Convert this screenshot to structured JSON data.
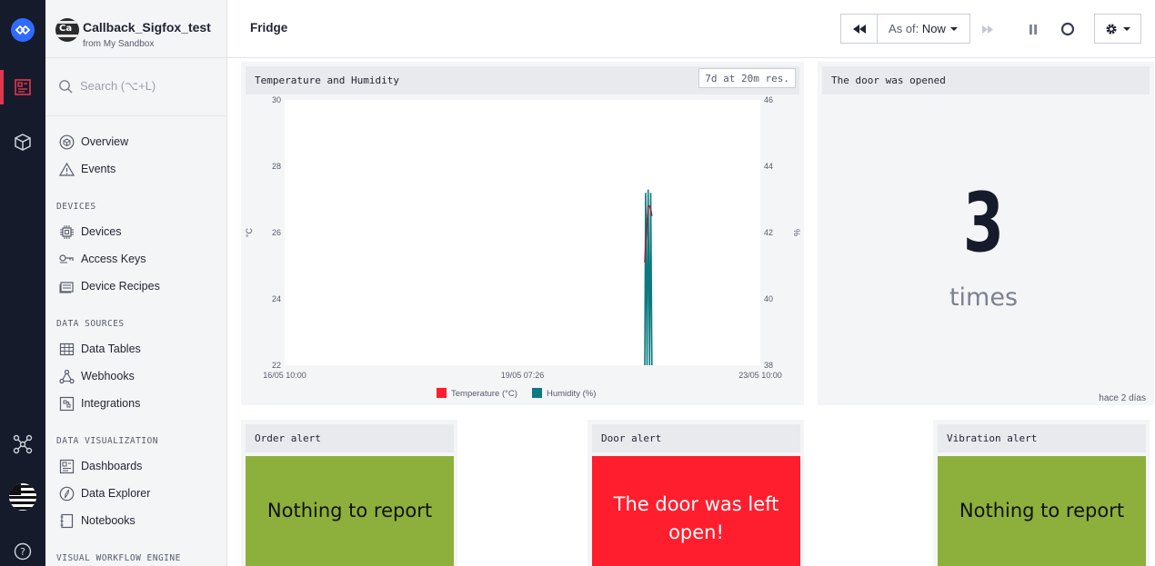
{
  "app": {
    "avatar_text": "Ca",
    "name": "Callback_Sigfox_test",
    "subtitle": "from My Sandbox"
  },
  "search": {
    "placeholder": "Search (⌥+L)"
  },
  "nav": {
    "overview": "Overview",
    "events": "Events",
    "devices_section": "DEVICES",
    "devices": "Devices",
    "access_keys": "Access Keys",
    "device_recipes": "Device Recipes",
    "data_sources_section": "DATA SOURCES",
    "data_tables": "Data Tables",
    "webhooks": "Webhooks",
    "integrations": "Integrations",
    "data_viz_section": "DATA VISUALIZATION",
    "dashboards": "Dashboards",
    "data_explorer": "Data Explorer",
    "notebooks": "Notebooks",
    "vwe_section": "VISUAL WORKFLOW ENGINE"
  },
  "header": {
    "title": "Fridge",
    "asof_label": "As of:",
    "asof_value": "Now"
  },
  "colors": {
    "accent": "#e0364f",
    "rail": "#161b2b",
    "temperature": "#ff1e2d",
    "humidity": "#0c7a7e",
    "ok": "#8db03c",
    "alarm": "#ff1e2d"
  },
  "chart_card": {
    "title": "Temperature and Humidity",
    "resolution": "7d at 20m res."
  },
  "chart_data": {
    "type": "line",
    "x_ticks": [
      "16/05 10:00",
      "19/05 07:26",
      "23/05 10:00"
    ],
    "y_left": {
      "label": "°C",
      "ticks": [
        30,
        28,
        26,
        24,
        22
      ],
      "range": [
        22,
        30
      ]
    },
    "y_right": {
      "label": "%",
      "ticks": [
        46,
        44,
        42,
        40,
        38
      ],
      "range": [
        38,
        46
      ]
    },
    "x_range": [
      0,
      168
    ],
    "series": [
      {
        "name": "Temperature (°C)",
        "color": "#ff1e2d",
        "axis": "left",
        "x": [
          127.2,
          127.5,
          128.0,
          128.4,
          128.9,
          129.3,
          129.7
        ],
        "y": [
          25.1,
          25.6,
          26.3,
          26.8,
          26.8,
          26.7,
          26.5
        ]
      },
      {
        "name": "Humidity (%)",
        "color": "#0c7a7e",
        "axis": "right",
        "x": [
          127.2,
          127.5,
          128.0,
          128.4,
          128.9,
          129.3,
          129.7
        ],
        "y": [
          38.0,
          43.2,
          38.0,
          43.3,
          38.0,
          43.2,
          38.0
        ]
      }
    ]
  },
  "door_card": {
    "title": "The door was opened",
    "value": "3",
    "unit": "times",
    "footer": "hace 2 días"
  },
  "alerts": {
    "order": {
      "title": "Order alert",
      "message": "Nothing to report"
    },
    "door": {
      "title": "Door alert",
      "message": "The door was left open!"
    },
    "vibration": {
      "title": "Vibration alert",
      "message": "Nothing to report"
    }
  }
}
